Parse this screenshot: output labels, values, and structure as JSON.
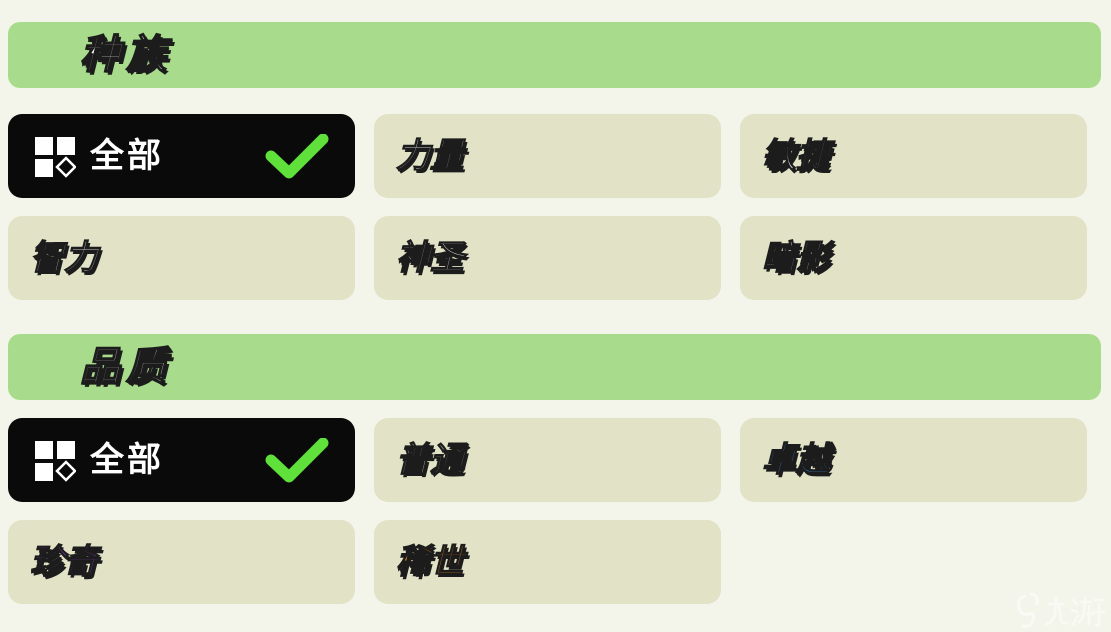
{
  "race_section": {
    "title": "种族",
    "options": [
      {
        "label": "全部",
        "selected": true
      },
      {
        "label": "力量",
        "color": "#ffffff"
      },
      {
        "label": "敏捷",
        "color": "#ffffff"
      },
      {
        "label": "智力",
        "color": "#ffffff"
      },
      {
        "label": "神圣",
        "color": "#ffffff"
      },
      {
        "label": "暗影",
        "color": "#ffffff"
      }
    ]
  },
  "quality_section": {
    "title": "品质",
    "options": [
      {
        "label": "全部",
        "selected": true
      },
      {
        "label": "普通",
        "color": "#e6f2d2"
      },
      {
        "label": "卓越",
        "color": "#2f8fe0"
      },
      {
        "label": "珍奇",
        "color": "#a23be0"
      },
      {
        "label": "稀世",
        "color": "#f08a12"
      }
    ]
  },
  "icons": {
    "all_icon": "grid-icon",
    "selected_icon": "check-icon",
    "watermark_icon": "jiuyou-logo-icon"
  },
  "colors": {
    "header_bg": "#a8dc8c",
    "button_bg": "#e1e2c6",
    "selected_bg": "#0a0a0a",
    "check_green": "#5fe03a",
    "page_bg": "#f4f5ea"
  }
}
